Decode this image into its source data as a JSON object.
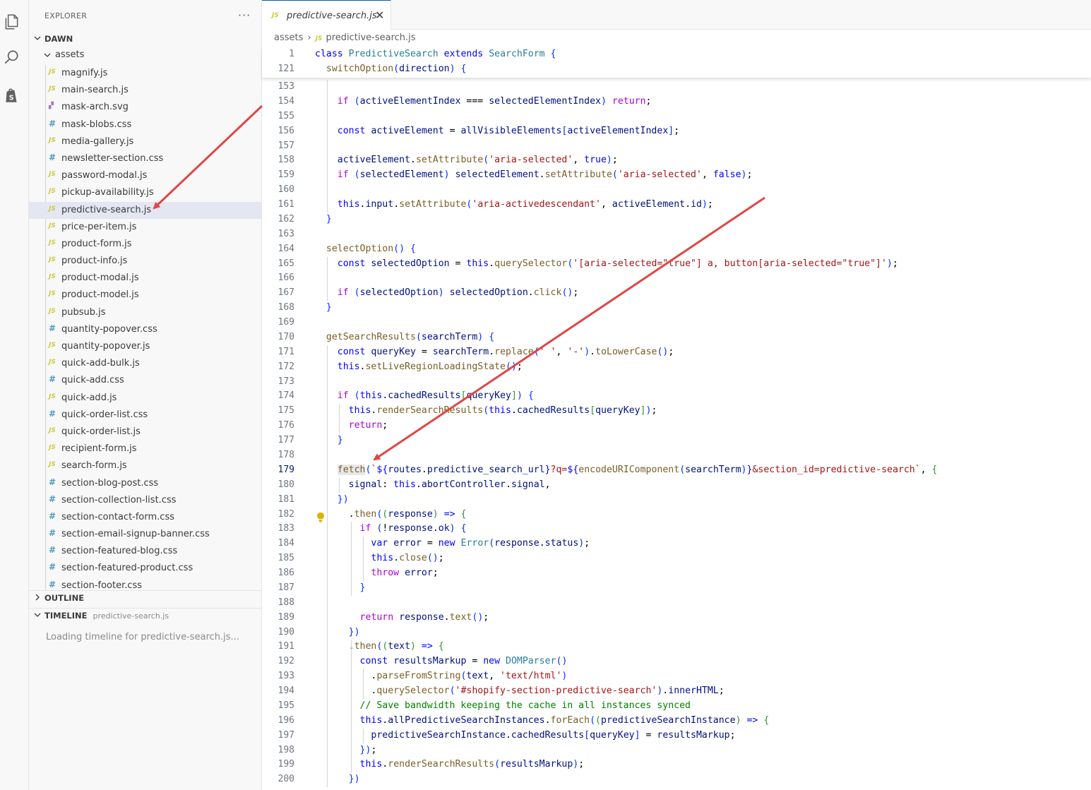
{
  "activity_bar": {
    "icons": [
      "files-icon",
      "search-icon",
      "shopify-icon"
    ]
  },
  "explorer": {
    "title": "EXPLORER",
    "more_actions": "···",
    "workspace": "DAWN",
    "folder": "assets",
    "files": [
      {
        "name": "magnify.js",
        "type": "js"
      },
      {
        "name": "main-search.js",
        "type": "js"
      },
      {
        "name": "mask-arch.svg",
        "type": "svg"
      },
      {
        "name": "mask-blobs.css",
        "type": "css"
      },
      {
        "name": "media-gallery.js",
        "type": "js"
      },
      {
        "name": "newsletter-section.css",
        "type": "css"
      },
      {
        "name": "password-modal.js",
        "type": "js"
      },
      {
        "name": "pickup-availability.js",
        "type": "js"
      },
      {
        "name": "predictive-search.js",
        "type": "js",
        "selected": true
      },
      {
        "name": "price-per-item.js",
        "type": "js"
      },
      {
        "name": "product-form.js",
        "type": "js"
      },
      {
        "name": "product-info.js",
        "type": "js"
      },
      {
        "name": "product-modal.js",
        "type": "js"
      },
      {
        "name": "product-model.js",
        "type": "js"
      },
      {
        "name": "pubsub.js",
        "type": "js"
      },
      {
        "name": "quantity-popover.css",
        "type": "css"
      },
      {
        "name": "quantity-popover.js",
        "type": "js"
      },
      {
        "name": "quick-add-bulk.js",
        "type": "js"
      },
      {
        "name": "quick-add.css",
        "type": "css"
      },
      {
        "name": "quick-add.js",
        "type": "js"
      },
      {
        "name": "quick-order-list.css",
        "type": "css"
      },
      {
        "name": "quick-order-list.js",
        "type": "js"
      },
      {
        "name": "recipient-form.js",
        "type": "js"
      },
      {
        "name": "search-form.js",
        "type": "js"
      },
      {
        "name": "section-blog-post.css",
        "type": "css"
      },
      {
        "name": "section-collection-list.css",
        "type": "css"
      },
      {
        "name": "section-contact-form.css",
        "type": "css"
      },
      {
        "name": "section-email-signup-banner.css",
        "type": "css"
      },
      {
        "name": "section-featured-blog.css",
        "type": "css"
      },
      {
        "name": "section-featured-product.css",
        "type": "css"
      },
      {
        "name": "section-footer.css",
        "type": "css"
      }
    ],
    "outline_label": "OUTLINE",
    "timeline_label": "TIMELINE",
    "timeline_file": "predictive-search.js",
    "timeline_loading": "Loading timeline for predictive-search.js..."
  },
  "editor": {
    "tab_label": "predictive-search.js",
    "tab_close": "✕",
    "breadcrumb_folder": "assets",
    "breadcrumb_file": "predictive-search.js",
    "sticky_lines": [
      {
        "num": "1",
        "text": "class PredictiveSearch extends SearchForm {"
      },
      {
        "num": "121",
        "text": "  switchOption(direction) {"
      }
    ],
    "lines": [
      {
        "num": "153",
        "text": ""
      },
      {
        "num": "154",
        "text": "    if (activeElementIndex === selectedElementIndex) return;"
      },
      {
        "num": "155",
        "text": ""
      },
      {
        "num": "156",
        "text": "    const activeElement = allVisibleElements[activeElementIndex];"
      },
      {
        "num": "157",
        "text": ""
      },
      {
        "num": "158",
        "text": "    activeElement.setAttribute('aria-selected', true);"
      },
      {
        "num": "159",
        "text": "    if (selectedElement) selectedElement.setAttribute('aria-selected', false);"
      },
      {
        "num": "160",
        "text": ""
      },
      {
        "num": "161",
        "text": "    this.input.setAttribute('aria-activedescendant', activeElement.id);"
      },
      {
        "num": "162",
        "text": "  }"
      },
      {
        "num": "163",
        "text": ""
      },
      {
        "num": "164",
        "text": "  selectOption() {"
      },
      {
        "num": "165",
        "text": "    const selectedOption = this.querySelector('[aria-selected=\"true\"] a, button[aria-selected=\"true\"]');"
      },
      {
        "num": "166",
        "text": ""
      },
      {
        "num": "167",
        "text": "    if (selectedOption) selectedOption.click();"
      },
      {
        "num": "168",
        "text": "  }"
      },
      {
        "num": "169",
        "text": ""
      },
      {
        "num": "170",
        "text": "  getSearchResults(searchTerm) {"
      },
      {
        "num": "171",
        "text": "    const queryKey = searchTerm.replace(' ', '-').toLowerCase();"
      },
      {
        "num": "172",
        "text": "    this.setLiveRegionLoadingState();"
      },
      {
        "num": "173",
        "text": ""
      },
      {
        "num": "174",
        "text": "    if (this.cachedResults[queryKey]) {"
      },
      {
        "num": "175",
        "text": "      this.renderSearchResults(this.cachedResults[queryKey]);"
      },
      {
        "num": "176",
        "text": "      return;"
      },
      {
        "num": "177",
        "text": "    }"
      },
      {
        "num": "178",
        "text": ""
      },
      {
        "num": "179",
        "text": "    fetch(`${routes.predictive_search_url}?q=${encodeURIComponent(searchTerm)}&section_id=predictive-search`, {"
      },
      {
        "num": "180",
        "text": "      signal: this.abortController.signal,"
      },
      {
        "num": "181",
        "text": "    })"
      },
      {
        "num": "182",
        "text": "      .then((response) => {"
      },
      {
        "num": "183",
        "text": "        if (!response.ok) {"
      },
      {
        "num": "184",
        "text": "          var error = new Error(response.status);"
      },
      {
        "num": "185",
        "text": "          this.close();"
      },
      {
        "num": "186",
        "text": "          throw error;"
      },
      {
        "num": "187",
        "text": "        }"
      },
      {
        "num": "188",
        "text": ""
      },
      {
        "num": "189",
        "text": "        return response.text();"
      },
      {
        "num": "190",
        "text": "      })"
      },
      {
        "num": "191",
        "text": "      .then((text) => {"
      },
      {
        "num": "192",
        "text": "        const resultsMarkup = new DOMParser()"
      },
      {
        "num": "193",
        "text": "          .parseFromString(text, 'text/html')"
      },
      {
        "num": "194",
        "text": "          .querySelector('#shopify-section-predictive-search').innerHTML;"
      },
      {
        "num": "195",
        "text": "        // Save bandwidth keeping the cache in all instances synced"
      },
      {
        "num": "196",
        "text": "        this.allPredictiveSearchInstances.forEach((predictiveSearchInstance) => {"
      },
      {
        "num": "197",
        "text": "          predictiveSearchInstance.cachedResults[queryKey] = resultsMarkup;"
      },
      {
        "num": "198",
        "text": "        });"
      },
      {
        "num": "199",
        "text": "        this.renderSearchResults(resultsMarkup);"
      },
      {
        "num": "200",
        "text": "      })"
      }
    ]
  },
  "colors": {
    "keyword": "#0000ff",
    "control": "#af00db",
    "function": "#795e26",
    "variable": "#001080",
    "string": "#a31515",
    "class": "#267f99",
    "comment": "#008000",
    "annotation_arrow": "#e04646"
  }
}
